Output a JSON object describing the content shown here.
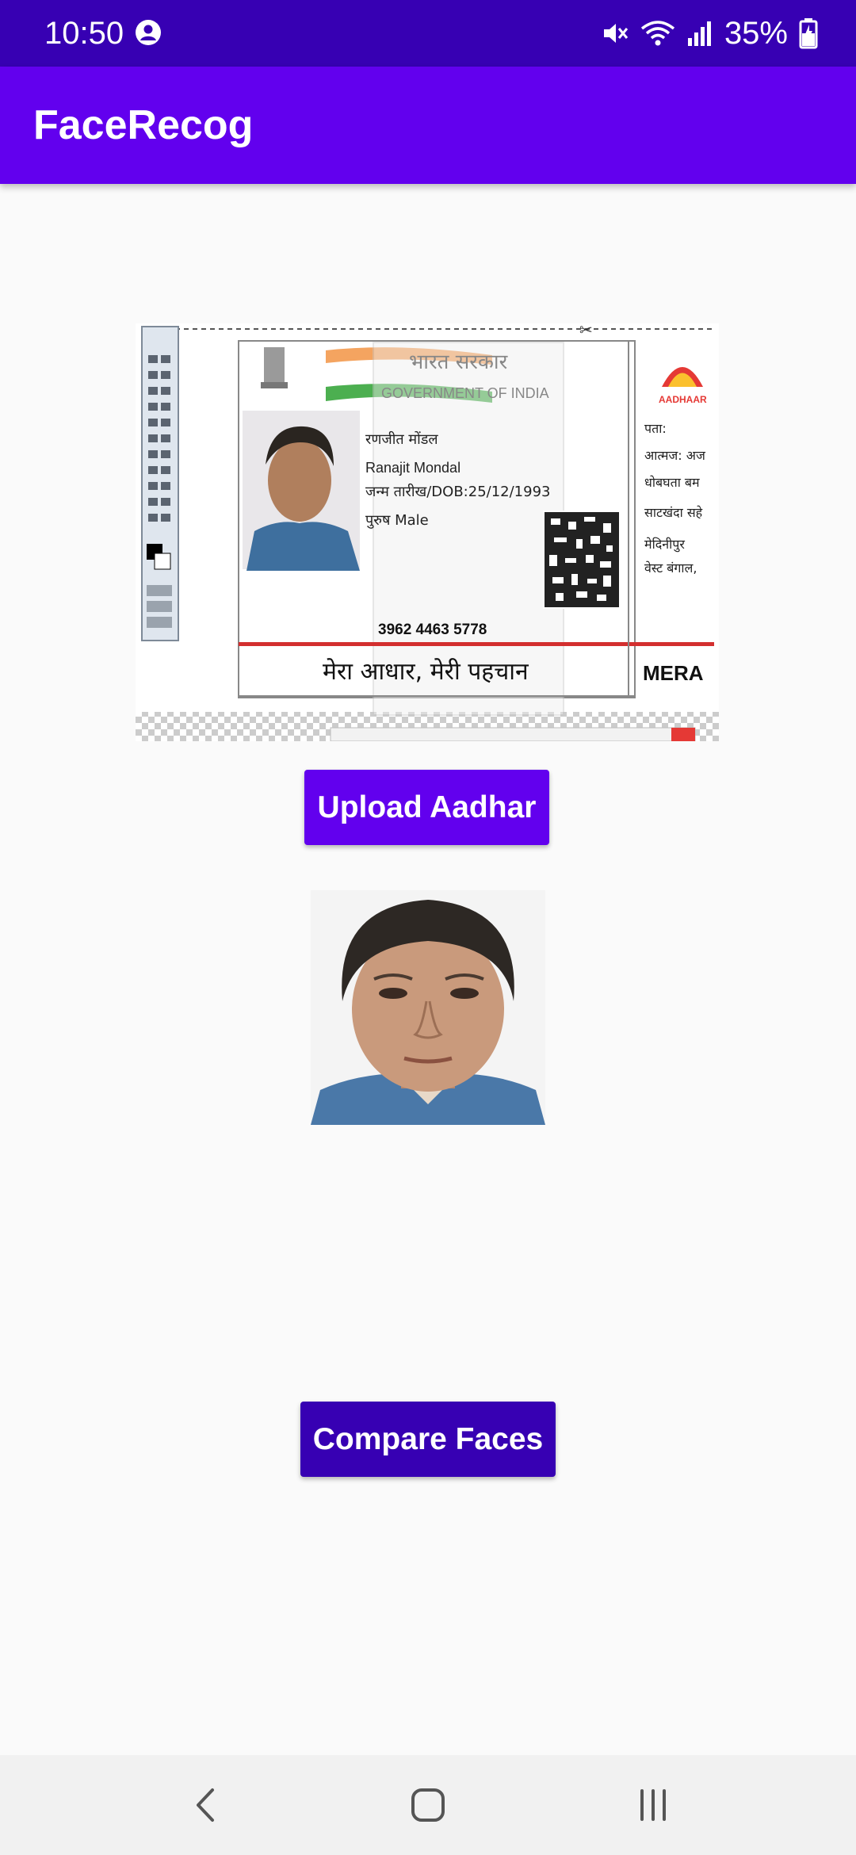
{
  "status_bar": {
    "time": "10:50",
    "battery_percent": "35%",
    "icons": [
      "account-icon",
      "mute-icon",
      "wifi-icon",
      "signal-icon",
      "battery-charging-icon"
    ]
  },
  "app_bar": {
    "title": "FaceRecog"
  },
  "aadhar_card": {
    "hindi_header": "भारत सरकार",
    "english_header": "GOVERNMENT OF INDIA",
    "name_hindi": "रणजीत मोंडल",
    "name_english": "Ranajit Mondal",
    "dob": "जन्म तारीख/DOB:25/12/1993",
    "gender": "पुरुष  Male",
    "number": "3962 4463 5778",
    "tagline": "मेरा आधार, मेरी पहचान",
    "aadhaar_logo": "AADHAAR",
    "back_label": "पता:",
    "back_line1": "आत्मज: अज",
    "back_line2": "धोबघता बम",
    "back_line3": "साटखंदा सहे",
    "back_line4": "मेदिनीपुर",
    "back_line5": "वेस्ट बंगाल,",
    "back_tagline": "MERA"
  },
  "buttons": {
    "upload": "Upload Aadhar",
    "compare": "Compare Faces"
  },
  "colors": {
    "primary": "#6200ee",
    "primary_dark": "#3700b3",
    "background": "#fafafa"
  },
  "nav_bar": {
    "icons": [
      "back-icon",
      "home-icon",
      "recents-icon"
    ]
  }
}
